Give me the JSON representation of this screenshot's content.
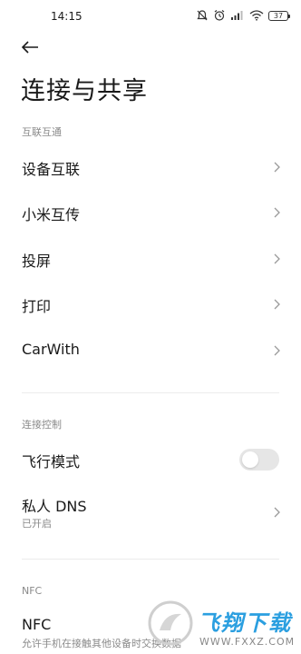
{
  "status_bar": {
    "time": "14:15",
    "battery": "37",
    "icons": [
      "mute-icon",
      "alarm-icon",
      "cellular-signal-icon",
      "wifi-icon",
      "battery-icon"
    ]
  },
  "header": {
    "title": "连接与共享"
  },
  "sections": {
    "interconnect": {
      "header": "互联互通",
      "items": [
        {
          "label": "设备互联"
        },
        {
          "label": "小米互传"
        },
        {
          "label": "投屏"
        },
        {
          "label": "打印"
        },
        {
          "label": "CarWith"
        }
      ]
    },
    "connection_control": {
      "header": "连接控制",
      "airplane_mode": {
        "label": "飞行模式",
        "enabled": false
      },
      "private_dns": {
        "label": "私人 DNS",
        "sub": "已开启"
      }
    },
    "nfc": {
      "header": "NFC",
      "item": {
        "label": "NFC",
        "sub": "允许手机在接触其他设备时交换数据"
      }
    }
  },
  "watermark": {
    "text": "飞翔下载",
    "url": "WWW.FXXZ.COM"
  },
  "colors": {
    "text_primary": "#1a1a1a",
    "text_secondary": "#8a8a8a",
    "toggle_off": "#e6e6e6",
    "watermark_blue": "#2b9fe0"
  }
}
